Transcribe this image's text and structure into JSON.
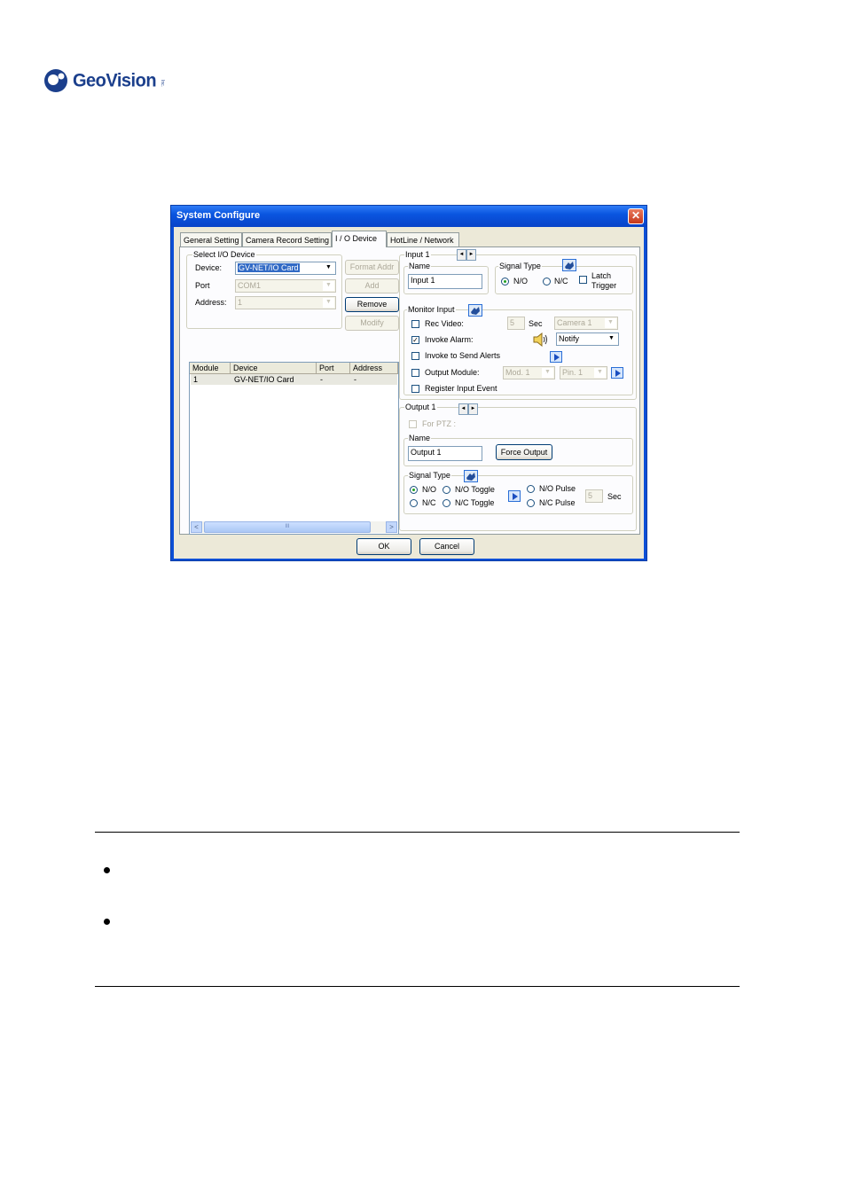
{
  "brand": {
    "name": "GeoVision",
    "tm": "Inc."
  },
  "window": {
    "title": "System Configure",
    "close_glyph": "✕",
    "tabs": [
      "General Setting",
      "Camera Record Setting",
      "I / O Device",
      "HotLine / Network"
    ],
    "active_tab": "I / O Device"
  },
  "select_io_device": {
    "group_label": "Select I/O Device",
    "device_label": "Device:",
    "device_value": "GV-NET/IO Card",
    "port_label": "Port",
    "port_value": "COM1",
    "address_label": "Address:",
    "address_value": "1",
    "buttons": {
      "format_addr": "Format Addr",
      "add": "Add",
      "remove": "Remove",
      "modify": "Modify"
    }
  },
  "device_list": {
    "columns": [
      "Module",
      "Device",
      "Port",
      "Address"
    ],
    "rows": [
      [
        "1",
        "GV-NET/IO Card",
        "-",
        "-"
      ]
    ],
    "scroll_left": "<",
    "scroll_right": ">",
    "scroll_grip": "III"
  },
  "input": {
    "group_label": "Input 1",
    "name_label": "Name",
    "name_value": "Input 1",
    "signal_type_label": "Signal Type",
    "no_label": "N/O",
    "nc_label": "N/C",
    "latch_label": "Latch",
    "trigger_label": "Trigger",
    "monitor_input_label": "Monitor Input",
    "rec_video_label": "Rec Video:",
    "rec_seconds": "5",
    "sec_label": "Sec",
    "camera_value": "Camera 1",
    "invoke_alarm_label": "Invoke Alarm:",
    "notify_value": "Notify",
    "invoke_alerts_label": "Invoke to Send Alerts",
    "output_module_label": "Output Module:",
    "mod_value": "Mod. 1",
    "pin_value": "Pin. 1",
    "register_event_label": "Register Input Event"
  },
  "output": {
    "group_label": "Output 1",
    "for_ptz_label": "For PTZ :",
    "name_label": "Name",
    "name_value": "Output 1",
    "force_output_label": "Force Output",
    "signal_type_label": "Signal Type",
    "no_label": "N/O",
    "nc_label": "N/C",
    "no_toggle_label": "N/O Toggle",
    "nc_toggle_label": "N/C Toggle",
    "no_pulse_label": "N/O Pulse",
    "nc_pulse_label": "N/C Pulse",
    "pulse_seconds": "5",
    "sec_label": "Sec"
  },
  "dialog_buttons": {
    "ok": "OK",
    "cancel": "Cancel"
  },
  "spin_left": "◄",
  "spin_right": "►",
  "dropdown_arrow": "▼",
  "checkmark": "✓"
}
